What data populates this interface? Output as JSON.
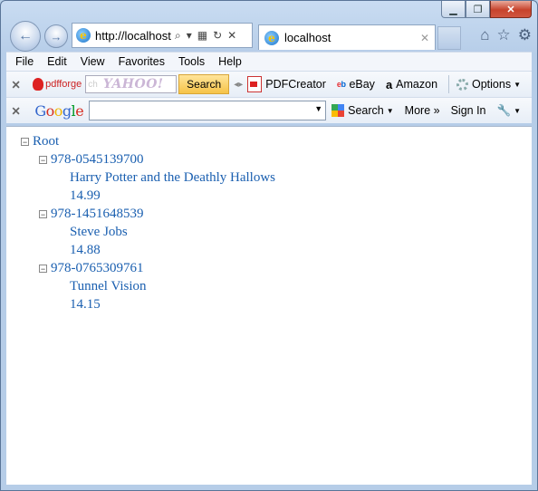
{
  "browser": {
    "address": "http://localhost:",
    "tab_title": "localhost"
  },
  "menubar": {
    "items": [
      "File",
      "Edit",
      "View",
      "Favorites",
      "Tools",
      "Help"
    ]
  },
  "yahoo_toolbar": {
    "brand": "pdfforge",
    "placeholder": "ch",
    "logo_text": "YAHOO!",
    "search_label": "Search",
    "links": [
      "PDFCreator",
      "eBay",
      "Amazon"
    ],
    "options_label": "Options"
  },
  "google_toolbar": {
    "logo": "Google",
    "search_label": "Search",
    "more_label": "More »",
    "sign_in_label": "Sign In"
  },
  "tree": {
    "root": "Root",
    "books": [
      {
        "isbn": "978-0545139700",
        "title": "Harry Potter and the Deathly Hallows",
        "price": "14.99"
      },
      {
        "isbn": "978-1451648539",
        "title": "Steve Jobs",
        "price": "14.88"
      },
      {
        "isbn": "978-0765309761",
        "title": "Tunnel Vision",
        "price": "14.15"
      }
    ]
  }
}
